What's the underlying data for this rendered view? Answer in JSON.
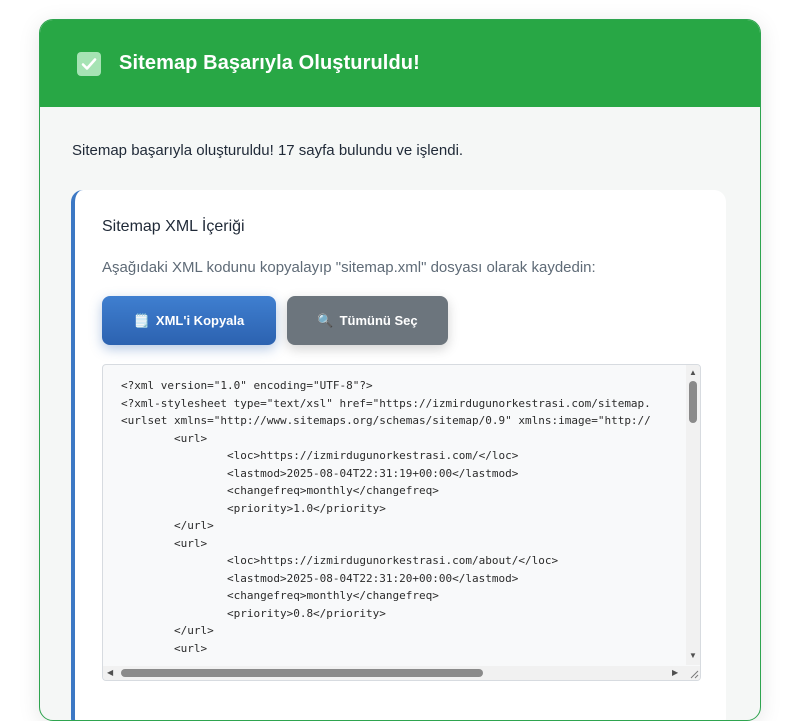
{
  "header": {
    "title": "Sitemap Başarıyla Oluşturuldu!",
    "icon": "check-square-icon",
    "accent": "#28a745"
  },
  "message": "Sitemap başarıyla oluşturuldu! 17 sayfa bulundu ve işlendi.",
  "panel": {
    "title": "Sitemap XML İçeriği",
    "description": "Aşağıdaki XML kodunu kopyalayıp \"sitemap.xml\" dosyası olarak kaydedin:",
    "border_color": "#3b78c4"
  },
  "buttons": {
    "copy": {
      "icon": "🗒️",
      "icon_name": "clipboard-icon",
      "label": "XML'i Kopyala",
      "color": "#3573c4"
    },
    "select_all": {
      "icon": "🔍",
      "icon_name": "magnifier-icon",
      "label": "Tümünü Seç",
      "color": "#6c757d"
    }
  },
  "xml_content": "<?xml version=\"1.0\" encoding=\"UTF-8\"?>\n<?xml-stylesheet type=\"text/xsl\" href=\"https://izmirdugunorkestrasi.com/sitemap.\n<urlset xmlns=\"http://www.sitemaps.org/schemas/sitemap/0.9\" xmlns:image=\"http://\n\t<url>\n\t\t<loc>https://izmirdugunorkestrasi.com/</loc>\n\t\t<lastmod>2025-08-04T22:31:19+00:00</lastmod>\n\t\t<changefreq>monthly</changefreq>\n\t\t<priority>1.0</priority>\n\t</url>\n\t<url>\n\t\t<loc>https://izmirdugunorkestrasi.com/about/</loc>\n\t\t<lastmod>2025-08-04T22:31:20+00:00</lastmod>\n\t\t<changefreq>monthly</changefreq>\n\t\t<priority>0.8</priority>\n\t</url>\n\t<url>"
}
